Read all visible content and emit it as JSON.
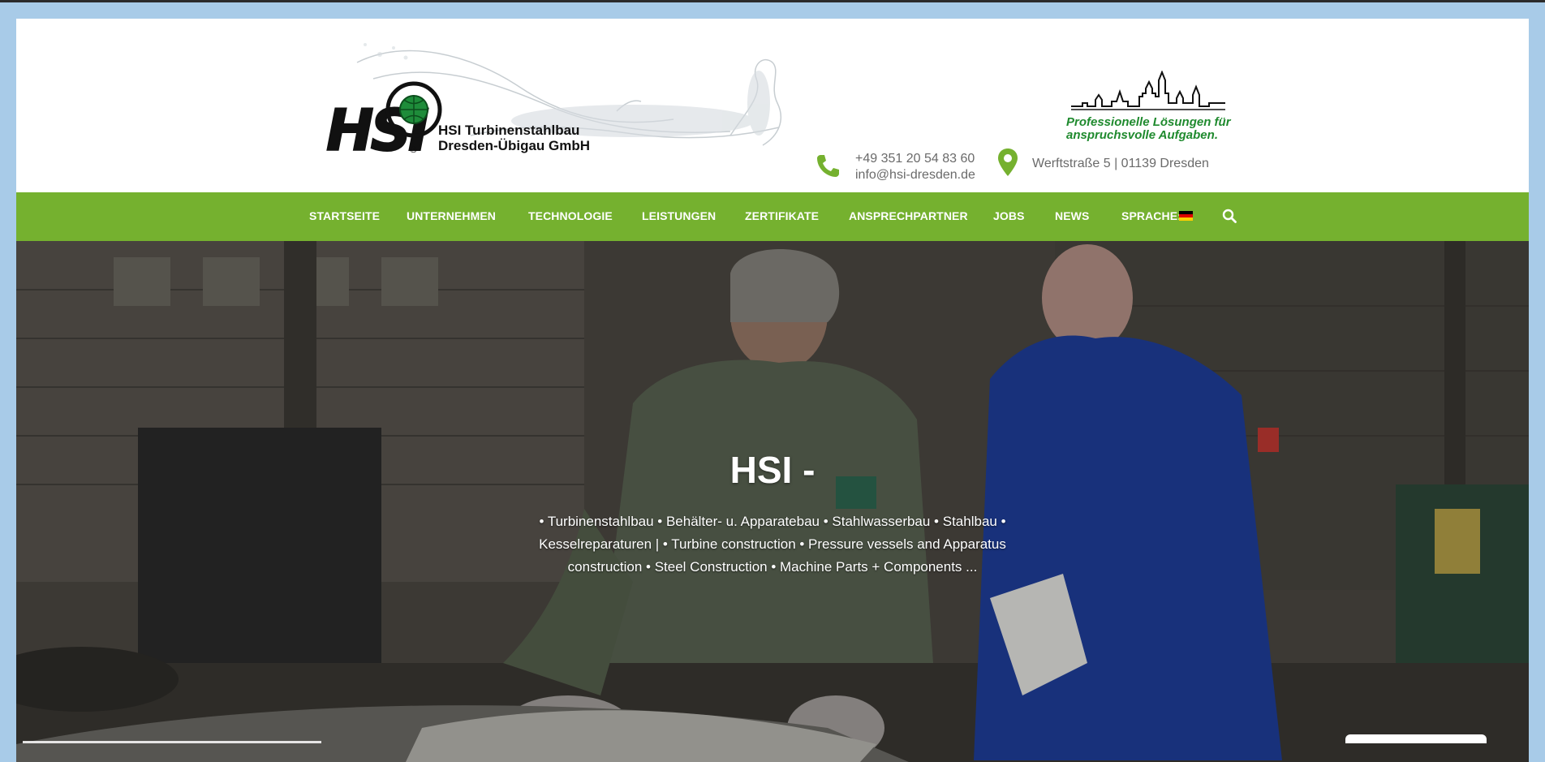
{
  "header": {
    "logo": {
      "mark": "HSI",
      "registered": "®",
      "line1": "HSI Turbinenstahlbau",
      "line2": "Dresden-Übigau GmbH"
    },
    "slogan_line1": "Professionelle Lösungen für",
    "slogan_line2": "anspruchsvolle Aufgaben.",
    "phone": "+49 351 20 54 83 60",
    "email": "info@hsi-dresden.de",
    "address": "Werftstraße 5 | 01139 Dresden"
  },
  "nav": {
    "items": [
      {
        "label": "STARTSEITE"
      },
      {
        "label": "UNTERNEHMEN"
      },
      {
        "label": "TECHNOLOGIE"
      },
      {
        "label": "LEISTUNGEN"
      },
      {
        "label": "ZERTIFIKATE"
      },
      {
        "label": "ANSPRECHPARTNER"
      },
      {
        "label": "JOBS"
      },
      {
        "label": "NEWS"
      },
      {
        "label": "SPRACHE:"
      }
    ],
    "language_flag": "flag-de-icon",
    "search_icon": "search-icon"
  },
  "hero": {
    "title": "HSI -",
    "subtitle_line1": "• Turbinenstahlbau • Behälter- u. Apparatebau • Stahlwasserbau • Stahlbau •",
    "subtitle_line2": "Kesselreparaturen | • Turbine construction • Pressure vessels and Apparatus",
    "subtitle_line3": "construction • Steel Construction • Machine Parts + Components ..."
  },
  "colors": {
    "brand_green": "#75b12f",
    "slogan_green": "#1f8a2e",
    "page_background": "#a8cbe8"
  }
}
